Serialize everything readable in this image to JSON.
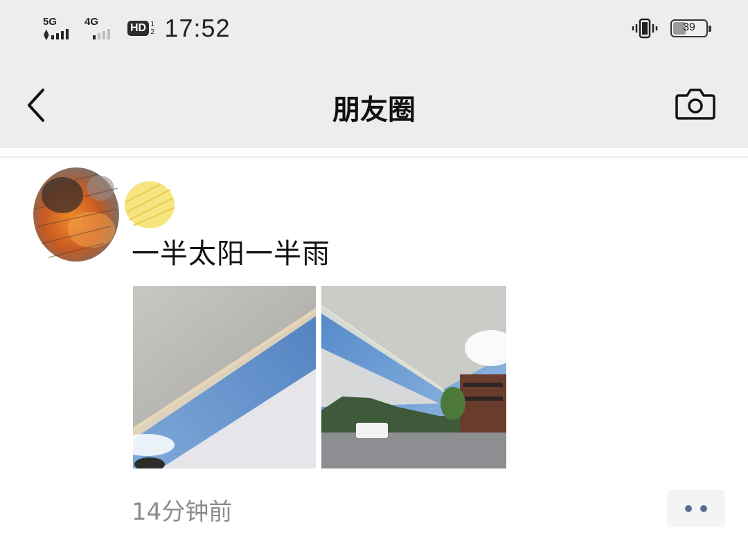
{
  "status_bar": {
    "signal1_label": "5G",
    "signal2_label": "4G",
    "hd_label": "HD",
    "hd_sub_top": "1",
    "hd_sub_bottom": "2",
    "time": "17:52",
    "battery": "39",
    "battery_level_percent": 39,
    "vibrate_icon": "vibrate-icon"
  },
  "nav": {
    "title": "朋友圈",
    "back_icon": "chevron-left-icon",
    "camera_icon": "camera-icon"
  },
  "post": {
    "text": "一半太阳一半雨",
    "photos": [
      "photo-1",
      "photo-2"
    ],
    "time_ago": "14分钟前",
    "more_icon": "more-dots-icon"
  },
  "colors": {
    "bar_bg": "#ededed",
    "timestamp": "#8c8c8c",
    "more_dots": "#5b6b93"
  }
}
